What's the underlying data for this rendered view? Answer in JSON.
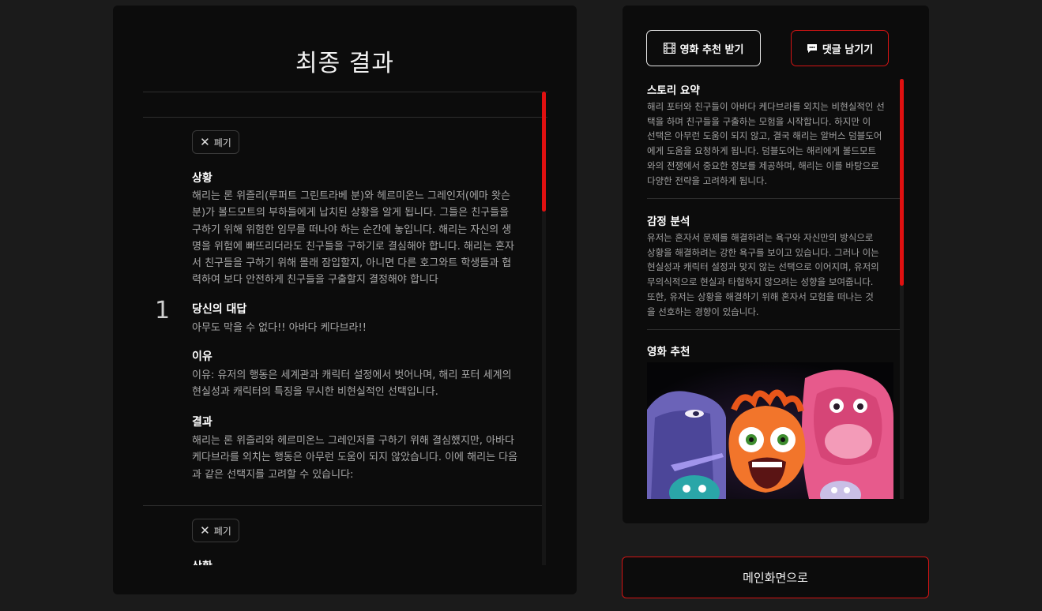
{
  "left": {
    "title": "최종 결과",
    "discard_label": "폐기",
    "rounds": [
      {
        "number": "1",
        "situation_heading": "상황",
        "situation_lines": [
          "해리는 론 위즐리(루퍼트 그린트라베 분)와 헤르미온느 그레인저(에마 왓슨",
          "분)가 볼드모트의 부하들에게 납치된 상황을 알게 됩니다. 그들은 친구들을",
          "구하기 위해 위험한 임무를 떠나야 하는 순간에 놓입니다. 해리는 자신의 생",
          "명을 위험에 빠뜨리더라도 친구들을 구하기로 결심해야 합니다. 해리는 혼자",
          "서 친구들을 구하기 위해 몰래 잠입할지, 아니면 다른 호그와트 학생들과 협",
          "력하여 보다 안전하게 친구들을 구출할지 결정해야 합니다"
        ],
        "answer_heading": "당신의 대답",
        "answer_text": "아무도 막을 수 없다!! 아바다 케다브라!!",
        "reason_heading": "이유",
        "reason_lines": [
          "이유: 유저의 행동은 세계관과 캐릭터 설정에서 벗어나며, 해리 포터 세계의",
          "현실성과 캐릭터의 특징을 무시한 비현실적인 선택입니다."
        ],
        "result_heading": "결과",
        "result_lines": [
          "해리는 론 위즐리와 헤르미온느 그레인저를 구하기 위해 결심했지만, 아바다",
          "케다브라를 외치는 행동은 아무런 도움이 되지 않았습니다. 이에 해리는 다음",
          "과 같은 선택지를 고려할 수 있습니다:"
        ]
      }
    ],
    "next_situation_heading": "상황"
  },
  "right": {
    "movie_button_label": "영화 추천 받기",
    "comment_button_label": "댓글 남기기",
    "story_heading": "스토리 요약",
    "story_lines": [
      "해리 포터와 친구들이 아바다 케다브라를 외치는 비현실적인 선",
      "택을 하며 친구들을 구출하는 모험을 시작합니다. 하지만 이",
      "선택은 아무런 도움이 되지 않고, 결국 해리는 알버스 덤블도어",
      "에게 도움을 요청하게 됩니다. 덤블도어는 해리에게 볼드모트",
      "와의 전쟁에서 중요한 정보를 제공하며, 해리는 이를 바탕으로",
      "다양한 전략을 고려하게 됩니다."
    ],
    "emotion_heading": "감정 분석",
    "emotion_lines": [
      "유저는 혼자서 문제를 해결하려는 욕구와 자신만의 방식으로",
      "상황을 해결하려는 강한 욕구를 보이고 있습니다. 그러나 이는",
      "현실성과 캐릭터 설정과 맞지 않는 선택으로 이어지며, 유저의",
      "무의식적으로 현실과 타협하지 않으려는 성향을 보여줍니다.",
      "또한, 유저는 상황을 해결하기 위해 혼자서 모험을 떠나는 것",
      "을 선호하는 경향이 있습니다."
    ],
    "movie_heading": "영화 추천"
  },
  "main_button_label": "메인화면으로",
  "colors": {
    "accent_red": "#e01010",
    "panel_bg": "#0c0c0c",
    "page_bg": "#1b1b1b"
  },
  "icons": {
    "movie_button_icon": "film-icon",
    "comment_button_icon": "chat-bubble-icon",
    "discard_icon": "close-icon"
  }
}
